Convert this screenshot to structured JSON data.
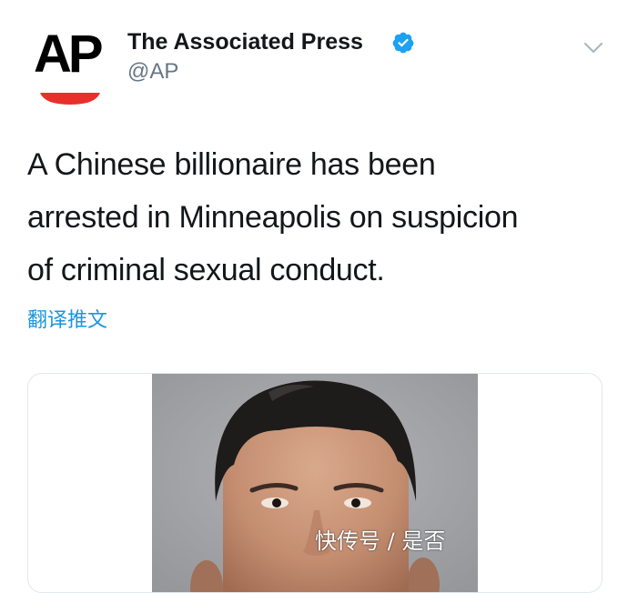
{
  "account": {
    "display_name": "The Associated Press",
    "handle": "@AP",
    "avatar_text": "AP",
    "verified": true
  },
  "tweet": {
    "text": "A Chinese billionaire has been arrested in Minneapolis on suspicion of criminal sexual conduct.",
    "lines": [
      "A Chinese billionaire has been",
      "arrested in Minneapolis on suspicion",
      "of criminal sexual conduct."
    ],
    "translate_label": "翻译推文"
  },
  "watermark": {
    "text": "快传号 / 是否"
  },
  "colors": {
    "link_blue": "#1b95e0",
    "verified_blue": "#1da1f2",
    "ap_red": "#e8302a",
    "handle_gray": "#657786",
    "card_border": "#e1e8ed"
  },
  "icons": {
    "verified": "verified-badge-icon",
    "menu": "chevron-down-icon"
  }
}
